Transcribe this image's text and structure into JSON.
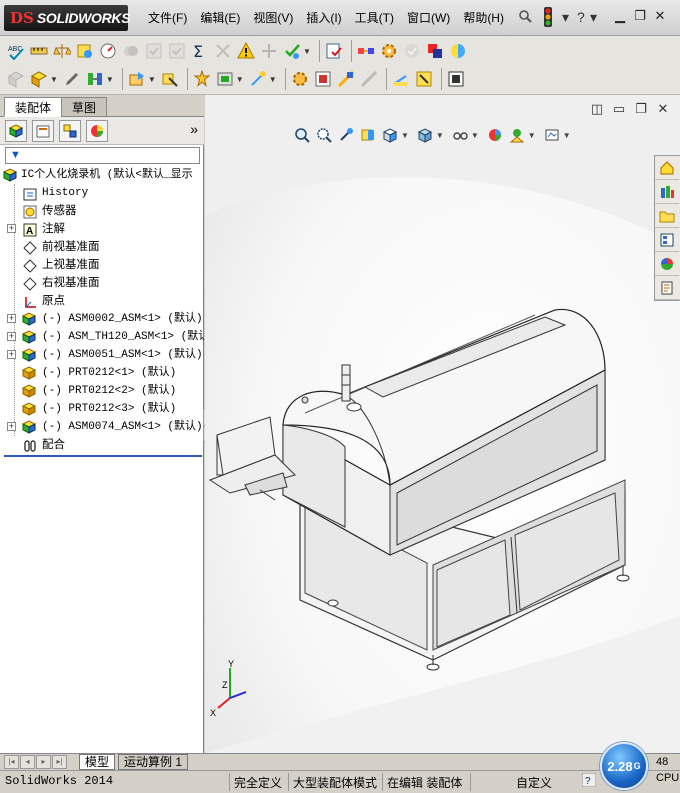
{
  "app": {
    "logo_prefix": "DS",
    "logo_text": "SOLIDWORKS"
  },
  "menu": [
    "文件(F)",
    "编辑(E)",
    "视图(V)",
    "插入(I)",
    "工具(T)",
    "窗口(W)",
    "帮助(H)"
  ],
  "title_tools": {
    "help": "?"
  },
  "panel_tabs": [
    "装配体",
    "草图"
  ],
  "tree": {
    "root": "IC个人化烧录机  (默认<默认_显示",
    "items": [
      {
        "label": "History"
      },
      {
        "label": "传感器"
      },
      {
        "label": "注解"
      },
      {
        "label": "前视基准面"
      },
      {
        "label": "上视基准面"
      },
      {
        "label": "右视基准面"
      },
      {
        "label": "原点"
      },
      {
        "label": "(-) ASM0002_ASM<1> (默认)"
      },
      {
        "label": "(-) ASM_TH120_ASM<1> (默认)"
      },
      {
        "label": "(-) ASM0051_ASM<1> (默认)"
      },
      {
        "label": "(-) PRT0212<1> (默认)"
      },
      {
        "label": "(-) PRT0212<2> (默认)"
      },
      {
        "label": "(-) PRT0212<3> (默认)"
      },
      {
        "label": "(-) ASM0074_ASM<1> (默认)"
      },
      {
        "label": "配合"
      }
    ]
  },
  "bottom_tabs": [
    "模型",
    "运动算例 1"
  ],
  "status": {
    "app": "SolidWorks 2014",
    "s1": "完全定义",
    "s2": "大型装配体模式",
    "s3": "在编辑 装配体",
    "s4": "自定义"
  },
  "memory": {
    "value": "2.28",
    "unit": "G"
  },
  "cpu": {
    "value": "48",
    "label": "CPU"
  },
  "triad": {
    "x": "X",
    "y": "Y",
    "z": "Z"
  },
  "colors": {
    "accent": "#2a5bb0",
    "selection": "#1a67c7"
  }
}
